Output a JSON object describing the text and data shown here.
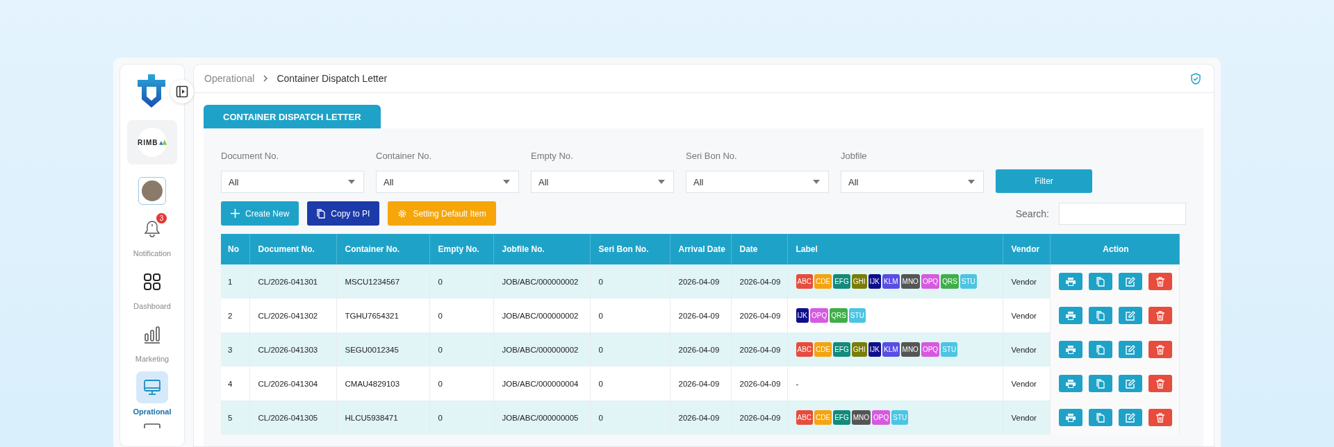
{
  "sidebar": {
    "badge_count": "3",
    "items": [
      {
        "label": "Notification",
        "kind": "bell",
        "selected": false
      },
      {
        "label": "Dashboard",
        "kind": "grid",
        "selected": false
      },
      {
        "label": "Marketing",
        "kind": "chart",
        "selected": false
      },
      {
        "label": "Oprational",
        "kind": "monitor",
        "selected": true
      }
    ],
    "company_logo": "RIMB"
  },
  "breadcrumb": {
    "parent": "Operational",
    "current": "Container Dispatch Letter"
  },
  "tab": {
    "label": "CONTAINER DISPATCH LETTER"
  },
  "filters": [
    {
      "label": "Document No.",
      "value": "All"
    },
    {
      "label": "Container No.",
      "value": "All"
    },
    {
      "label": "Empty No.",
      "value": "All"
    },
    {
      "label": "Seri Bon No.",
      "value": "All"
    },
    {
      "label": "Jobfile",
      "value": "All"
    }
  ],
  "filter_button": "Filter",
  "actions": [
    {
      "kind": "create",
      "label": "Create New"
    },
    {
      "kind": "copy",
      "label": "Copy to PI"
    },
    {
      "kind": "setting",
      "label": "Setting Default Item"
    }
  ],
  "search": {
    "label": "Search:"
  },
  "table": {
    "columns": [
      "No",
      "Document No.",
      "Container No.",
      "Empty No.",
      "Jobfile No.",
      "Seri Bon No.",
      "Arrival Date",
      "Date",
      "Label",
      "Vendor",
      "Action"
    ],
    "rows": [
      {
        "cells": [
          "1",
          "CL/2026-041301",
          "MSCU1234567",
          "0",
          "JOB/ABC/000000002",
          "0",
          "2026-04-09",
          "2026-04-09"
        ],
        "labels": [
          {
            "text": "ABC",
            "color": "#e74c3c"
          },
          {
            "text": "CDE",
            "color": "#f5a30f"
          },
          {
            "text": "EFG",
            "color": "#138a7b"
          },
          {
            "text": "GHI",
            "color": "#7a7d08"
          },
          {
            "text": "IJK",
            "color": "#0f0f8c"
          },
          {
            "text": "KLM",
            "color": "#5a4de3"
          },
          {
            "text": "MNO",
            "color": "#555555"
          },
          {
            "text": "OPQ",
            "color": "#d55ae0"
          },
          {
            "text": "QRS",
            "color": "#3fae49"
          },
          {
            "text": "STU",
            "color": "#4bc5e3"
          }
        ],
        "vendor": "Vendor"
      },
      {
        "cells": [
          "2",
          "CL/2026-041302",
          "TGHU7654321",
          "0",
          "JOB/ABC/000000002",
          "0",
          "2026-04-09",
          "2026-04-09"
        ],
        "labels": [
          {
            "text": "IJK",
            "color": "#0f0f8c"
          },
          {
            "text": "OPQ",
            "color": "#d55ae0"
          },
          {
            "text": "QRS",
            "color": "#3fae49"
          },
          {
            "text": "STU",
            "color": "#4bc5e3"
          }
        ],
        "vendor": "Vendor"
      },
      {
        "cells": [
          "3",
          "CL/2026-041303",
          "SEGU0012345",
          "0",
          "JOB/ABC/000000002",
          "0",
          "2026-04-09",
          "2026-04-09"
        ],
        "labels": [
          {
            "text": "ABC",
            "color": "#e74c3c"
          },
          {
            "text": "CDE",
            "color": "#f5a30f"
          },
          {
            "text": "EFG",
            "color": "#138a7b"
          },
          {
            "text": "GHI",
            "color": "#7a7d08"
          },
          {
            "text": "IJK",
            "color": "#0f0f8c"
          },
          {
            "text": "KLM",
            "color": "#5a4de3"
          },
          {
            "text": "MNO",
            "color": "#555555"
          },
          {
            "text": "OPQ",
            "color": "#d55ae0"
          },
          {
            "text": "STU",
            "color": "#4bc5e3"
          }
        ],
        "vendor": "Vendor"
      },
      {
        "cells": [
          "4",
          "CL/2026-041304",
          "CMAU4829103",
          "0",
          "JOB/ABC/000000004",
          "0",
          "2026-04-09",
          "2026-04-09"
        ],
        "labels": [],
        "label_placeholder": "-",
        "vendor": "Vendor"
      },
      {
        "cells": [
          "5",
          "CL/2026-041305",
          "HLCU5938471",
          "0",
          "JOB/ABC/000000005",
          "0",
          "2026-04-09",
          "2026-04-09"
        ],
        "labels": [
          {
            "text": "ABC",
            "color": "#e74c3c"
          },
          {
            "text": "CDE",
            "color": "#f5a30f"
          },
          {
            "text": "EFG",
            "color": "#138a7b"
          },
          {
            "text": "MNO",
            "color": "#555555"
          },
          {
            "text": "OPQ",
            "color": "#d55ae0"
          },
          {
            "text": "STU",
            "color": "#4bc5e3"
          }
        ],
        "vendor": "Vendor"
      }
    ]
  }
}
